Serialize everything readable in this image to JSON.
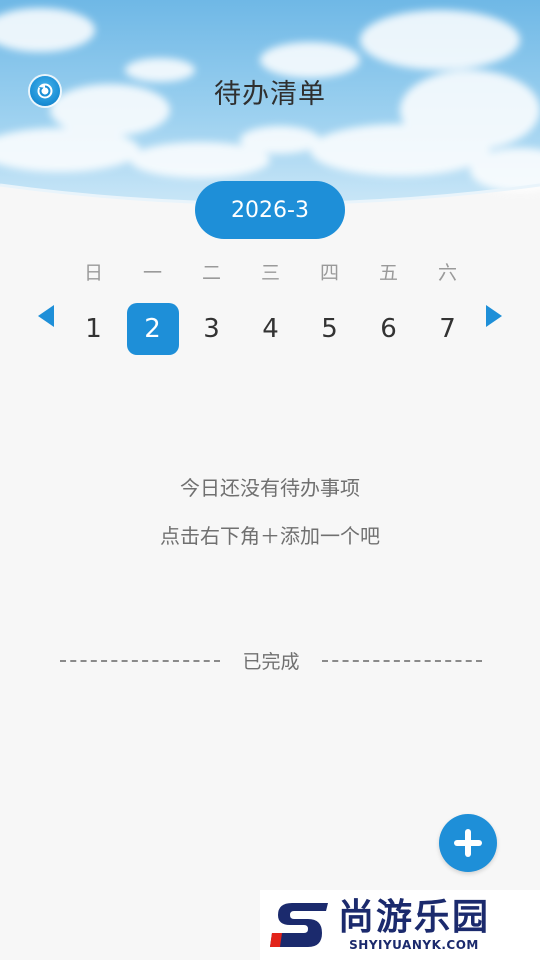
{
  "header": {
    "title": "待办清单",
    "back_icon": "refresh-back-icon"
  },
  "calendar": {
    "month": "2026-3",
    "weekdays": [
      "日",
      "一",
      "二",
      "三",
      "四",
      "五",
      "六"
    ],
    "dates": [
      "1",
      "2",
      "3",
      "4",
      "5",
      "6",
      "7"
    ],
    "selected_index": 1,
    "prev_icon": "triangle-left-icon",
    "next_icon": "triangle-right-icon"
  },
  "empty_state": {
    "line1": "今日还没有待办事项",
    "line2": "点击右下角＋添加一个吧"
  },
  "completed_section": {
    "label": "已完成"
  },
  "fab": {
    "icon": "plus-icon"
  },
  "watermark": {
    "brand": "尚游乐园",
    "url": "SHYIYUANYK.COM"
  },
  "colors": {
    "accent": "#1e8fd8",
    "background": "#f7f7f7",
    "sky": "#8cc8ec"
  }
}
